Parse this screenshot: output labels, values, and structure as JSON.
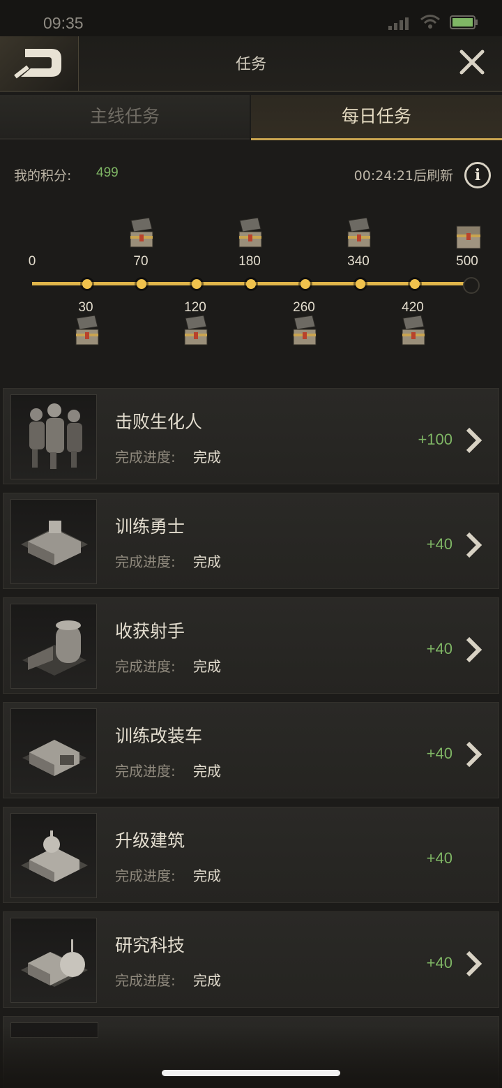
{
  "status_bar": {
    "time": "09:35"
  },
  "header": {
    "title": "任务"
  },
  "tabs": [
    {
      "label": "主线任务",
      "active": false
    },
    {
      "label": "每日任务",
      "active": true
    }
  ],
  "points": {
    "label": "我的积分:",
    "value": "499",
    "refresh": "00:24:21后刷新"
  },
  "milestones": {
    "top": [
      "0",
      "70",
      "180",
      "340",
      "500"
    ],
    "bottom": [
      "30",
      "120",
      "260",
      "420"
    ]
  },
  "progress_fraction": 1.0,
  "tasks": [
    {
      "name": "击败生化人",
      "progress_label": "完成进度:",
      "progress_value": "完成",
      "reward": "+100",
      "has_arrow": true,
      "icon": "zombies-icon"
    },
    {
      "name": "训练勇士",
      "progress_label": "完成进度:",
      "progress_value": "完成",
      "reward": "+40",
      "has_arrow": true,
      "icon": "barracks-icon"
    },
    {
      "name": "收获射手",
      "progress_label": "完成进度:",
      "progress_value": "完成",
      "reward": "+40",
      "has_arrow": true,
      "icon": "shooter-camp-icon"
    },
    {
      "name": "训练改装车",
      "progress_label": "完成进度:",
      "progress_value": "完成",
      "reward": "+40",
      "has_arrow": true,
      "icon": "garage-icon"
    },
    {
      "name": "升级建筑",
      "progress_label": "完成进度:",
      "progress_value": "完成",
      "reward": "+40",
      "has_arrow": false,
      "icon": "capitol-building-icon"
    },
    {
      "name": "研究科技",
      "progress_label": "完成进度:",
      "progress_value": "完成",
      "reward": "+40",
      "has_arrow": true,
      "icon": "research-lab-icon"
    }
  ],
  "colors": {
    "accent_gold": "#e0b54a",
    "reward_green": "#7fb665"
  }
}
